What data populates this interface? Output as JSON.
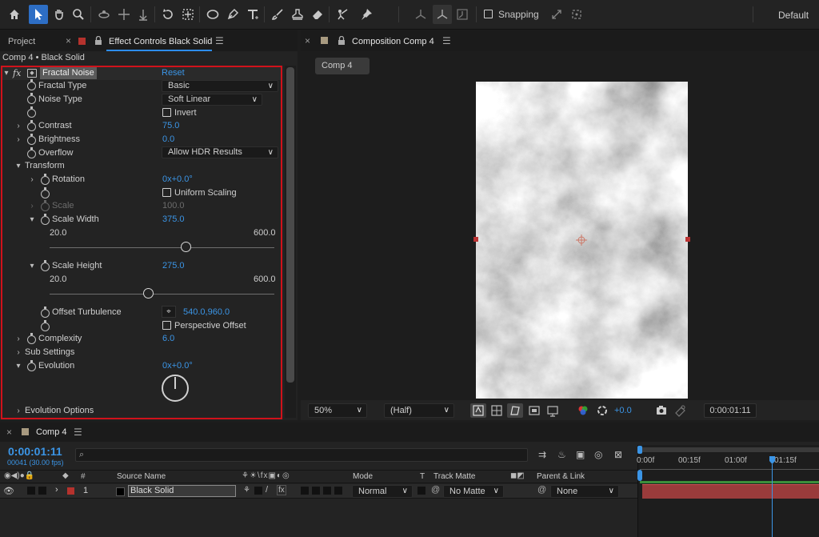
{
  "toolbar": {
    "snapping_label": "Snapping",
    "workspace_label": "Default",
    "tools": [
      "home-icon",
      "selection-icon",
      "hand-icon",
      "zoom-icon",
      "orbit-camera-icon",
      "track-camera-icon",
      "dolly-camera-icon",
      "rotate-icon",
      "pan-behind-icon",
      "mask-ellipse-icon",
      "pen-icon",
      "type-icon",
      "brush-icon",
      "clone-stamp-icon",
      "eraser-icon",
      "roto-brush-icon",
      "puppet-pin-icon"
    ]
  },
  "left_panel": {
    "tab_project": "Project",
    "tab_effect_controls": "Effect Controls Black Solid",
    "layer_path": "Comp 4 • Black Solid",
    "effect": {
      "name": "Fractal Noise",
      "reset": "Reset",
      "fx": "fx"
    },
    "props": {
      "fractal_type": {
        "label": "Fractal Type",
        "value": "Basic"
      },
      "noise_type": {
        "label": "Noise Type",
        "value": "Soft Linear"
      },
      "invert": {
        "label": "Invert"
      },
      "contrast": {
        "label": "Contrast",
        "value": "75.0"
      },
      "brightness": {
        "label": "Brightness",
        "value": "0.0"
      },
      "overflow": {
        "label": "Overflow",
        "value": "Allow HDR Results"
      },
      "transform": {
        "label": "Transform"
      },
      "rotation": {
        "label": "Rotation",
        "value": "0x+0.0°"
      },
      "uniform_scaling": {
        "label": "Uniform Scaling"
      },
      "scale": {
        "label": "Scale",
        "value": "100.0"
      },
      "scale_width": {
        "label": "Scale Width",
        "value": "375.0",
        "min": "20.0",
        "max": "600.0",
        "fraction": 0.61
      },
      "scale_height": {
        "label": "Scale Height",
        "value": "275.0",
        "min": "20.0",
        "max": "600.0",
        "fraction": 0.44
      },
      "offset_turbulence": {
        "label": "Offset Turbulence",
        "value": "540.0,960.0"
      },
      "perspective_offset": {
        "label": "Perspective Offset"
      },
      "complexity": {
        "label": "Complexity",
        "value": "6.0"
      },
      "sub_settings": {
        "label": "Sub Settings"
      },
      "evolution": {
        "label": "Evolution",
        "value": "0x+0.0°"
      },
      "evolution_options": {
        "label": "Evolution Options"
      }
    }
  },
  "comp_panel": {
    "tab_title": "Composition Comp 4",
    "comp_button": "Comp 4",
    "zoom": "50%",
    "resolution": "(Half)",
    "exposure": "+0.0",
    "timecode": "0:00:01:11"
  },
  "timeline": {
    "tab_title": "Comp 4",
    "current_time": "0:00:01:11",
    "frame_info": "00041 (30.00 fps)",
    "search_placeholder": "",
    "col_number": "#",
    "col_source_name": "Source Name",
    "col_mode": "Mode",
    "col_t": "T",
    "col_track_matte": "Track Matte",
    "col_parent": "Parent & Link",
    "ruler": [
      "0:00f",
      "00:15f",
      "01:00f",
      "01:15f"
    ],
    "layer": {
      "index": "1",
      "name": "Black Solid",
      "mode": "Normal",
      "track_matte": "No Matte",
      "parent": "None"
    }
  },
  "colors": {
    "accent": "#2d8ceb",
    "value_blue": "#3b95e6",
    "highlight_red": "#d0121b",
    "layer_bar": "#9a3b3b",
    "timecode_blue": "#3b95e6"
  }
}
